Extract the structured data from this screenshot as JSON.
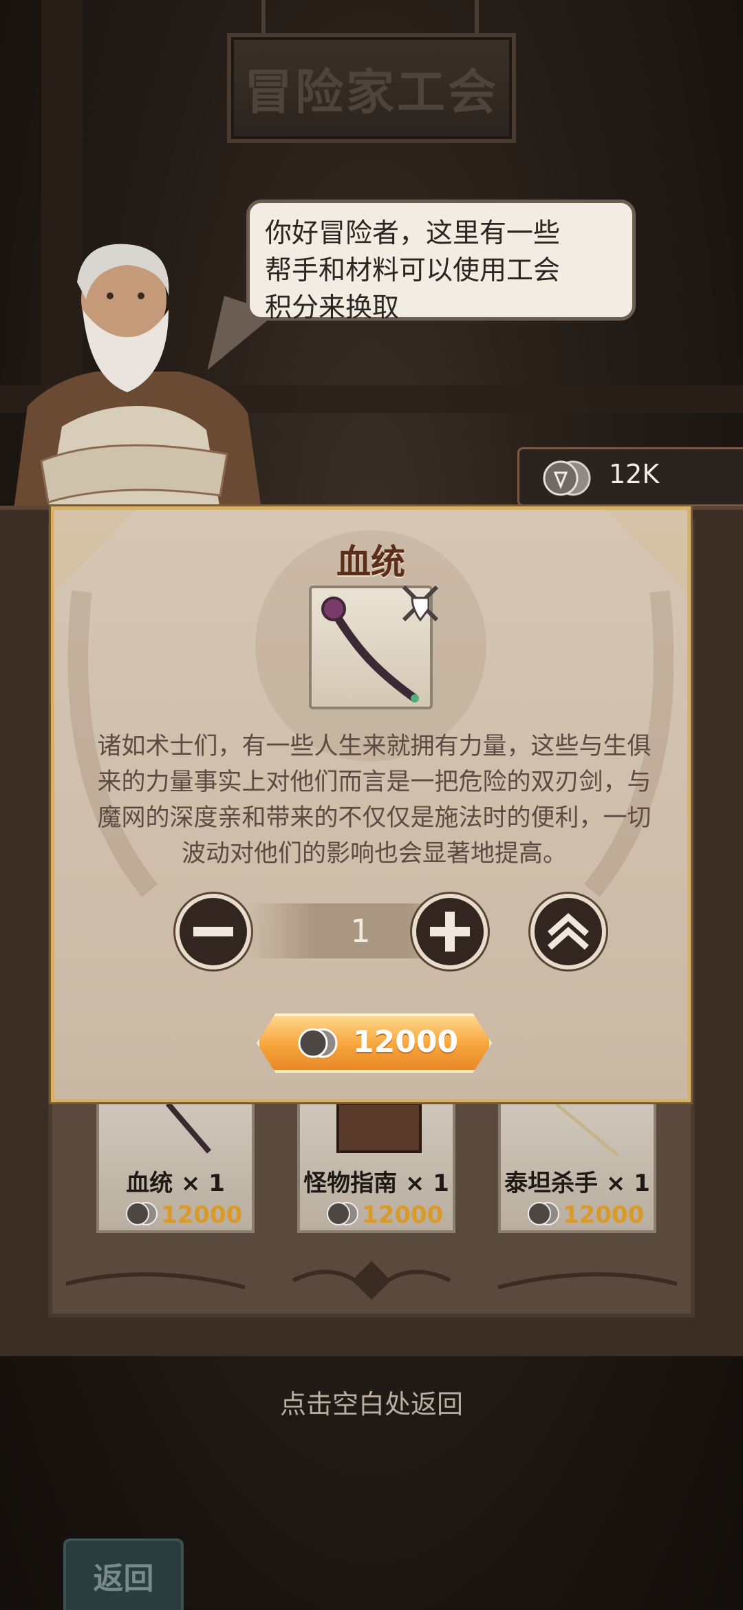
{
  "header": {
    "guild_sign": "冒险家工会"
  },
  "npc": {
    "dialogue": [
      "你好冒险者，这里有一些",
      "帮手和材料可以使用工会",
      "积分来换取"
    ]
  },
  "currency": {
    "icon": "guild-coin-icon",
    "value": "12K"
  },
  "modal": {
    "title": "血统",
    "item_icon": "staff-icon",
    "badge_icon": "crossed-swords-shield-icon",
    "description": "诸如术士们，有一些人生来就拥有力量，这些与生俱来的力量事实上对他们而言是一把危险的双刃剑，与魔网的深度亲和带来的不仅仅是施法时的便利，一切波动对他们的影响也会显著地提高。",
    "quantity": "1",
    "price": "12000"
  },
  "shop_items": [
    {
      "name": "血统 × 1",
      "price": "12000",
      "icon": "staff-icon"
    },
    {
      "name": "怪物指南 × 1",
      "price": "12000",
      "icon": "book-icon"
    },
    {
      "name": "泰坦杀手 × 1",
      "price": "12000",
      "icon": "spear-icon"
    }
  ],
  "footer": {
    "dismiss_hint": "点击空白处返回",
    "back_label": "返回"
  }
}
